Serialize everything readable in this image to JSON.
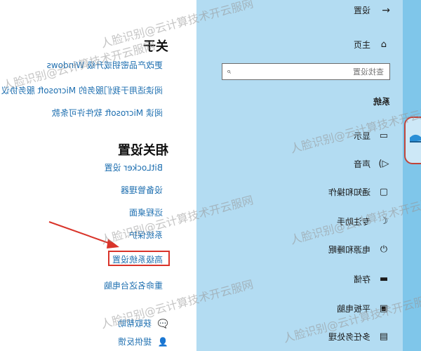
{
  "settings_nav": {
    "back_label": "设置",
    "home_label": "主页",
    "search_placeholder": "查找设置",
    "section_label": "系统",
    "items": [
      {
        "icon": "monitor-icon",
        "glyph": "▭",
        "label": "显示"
      },
      {
        "icon": "speaker-icon",
        "glyph": "◁)",
        "label": "声音"
      },
      {
        "icon": "notification-icon",
        "glyph": "▢",
        "label": "通知和操作"
      },
      {
        "icon": "moon-icon",
        "glyph": "☾",
        "label": "专注助手"
      },
      {
        "icon": "power-icon",
        "glyph": "⏻",
        "label": "电源和睡眠"
      },
      {
        "icon": "storage-icon",
        "glyph": "▬",
        "label": "存储"
      },
      {
        "icon": "tablet-icon",
        "glyph": "▣",
        "label": "平板电脑"
      },
      {
        "icon": "multitask-icon",
        "glyph": "▤",
        "label": "多任务处理"
      }
    ]
  },
  "about_panel": {
    "title": "关于",
    "links": [
      "更改产品密钥或升级 Windows",
      "阅读适用于我们服务的 Microsoft 服务协议",
      "阅读 Microsoft 软件许可条款"
    ],
    "related_heading": "相关设置",
    "related_links": [
      "BitLocker 设置",
      "设备管理器",
      "远程桌面",
      "系统保护",
      "高级系统设置",
      "重命名这台电脑"
    ],
    "help": [
      {
        "icon": "help-chat-icon",
        "glyph": "💬",
        "label": "获取帮助"
      },
      {
        "icon": "feedback-icon",
        "glyph": "👤",
        "label": "提供反馈"
      }
    ]
  },
  "desktop": {
    "icon_name": "desktop-app-icon"
  },
  "watermark_text": "人脸识别@云计算技术开云服网",
  "colors": {
    "nav_bg": "#b3dcf2",
    "link": "#1e6fb0",
    "highlight": "#d9342a"
  }
}
